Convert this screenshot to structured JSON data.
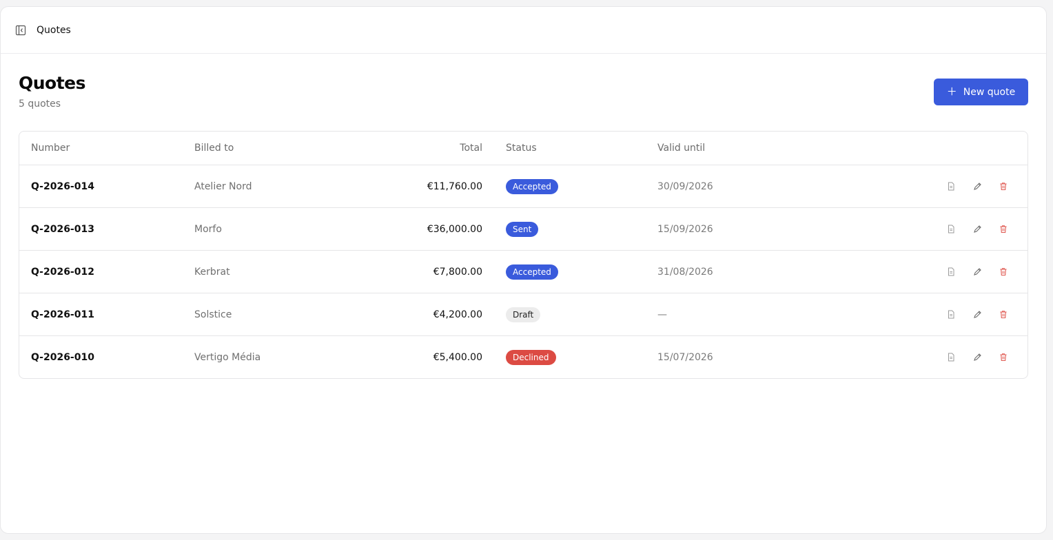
{
  "topbar": {
    "toggle_icon": "sidebar-collapse-icon",
    "breadcrumb": "Quotes"
  },
  "header": {
    "title": "Quotes",
    "count": "5 quotes",
    "new_button": {
      "icon": "plus-icon",
      "label": "New quote"
    }
  },
  "table": {
    "columns": {
      "number": "Number",
      "billed_to": "Billed to",
      "total": "Total",
      "status": "Status",
      "valid_until": "Valid until"
    },
    "rows": [
      {
        "number": "Q-2026-014",
        "billed_to": "Atelier Nord",
        "total": "€11,760.00",
        "status": "Accepted",
        "status_kind": "accepted",
        "valid_until": "30/09/2026"
      },
      {
        "number": "Q-2026-013",
        "billed_to": "Morfo",
        "total": "€36,000.00",
        "status": "Sent",
        "status_kind": "sent",
        "valid_until": "15/09/2026"
      },
      {
        "number": "Q-2026-012",
        "billed_to": "Kerbrat",
        "total": "€7,800.00",
        "status": "Accepted",
        "status_kind": "accepted",
        "valid_until": "31/08/2026"
      },
      {
        "number": "Q-2026-011",
        "billed_to": "Solstice",
        "total": "€4,200.00",
        "status": "Draft",
        "status_kind": "draft",
        "valid_until": "—"
      },
      {
        "number": "Q-2026-010",
        "billed_to": "Vertigo Média",
        "total": "€5,400.00",
        "status": "Declined",
        "status_kind": "declined",
        "valid_until": "15/07/2026"
      }
    ],
    "row_actions": [
      "document-icon",
      "pencil-icon",
      "trash-icon"
    ]
  },
  "colors": {
    "accent": "#3a5bdc",
    "danger": "#dc4b43",
    "draft_bg": "#ececec"
  }
}
